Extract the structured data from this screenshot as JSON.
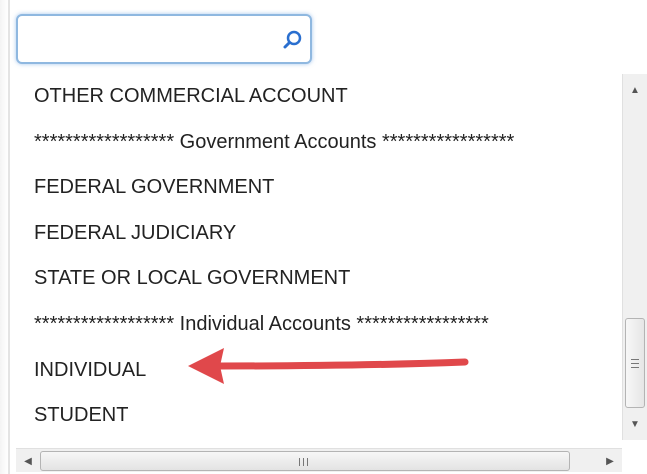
{
  "search": {
    "value": "",
    "placeholder": ""
  },
  "list": {
    "items": [
      "OTHER COMMERCIAL ACCOUNT",
      "****************** Government Accounts *****************",
      "FEDERAL GOVERNMENT",
      "FEDERAL JUDICIARY",
      "STATE OR LOCAL GOVERNMENT",
      "****************** Individual Accounts *****************",
      "INDIVIDUAL",
      "STUDENT"
    ]
  },
  "colors": {
    "arrow": "#e0484b",
    "focus_border": "#8fb8e0",
    "search_icon": "#2a6fcf"
  },
  "icons": {
    "search": "search-icon",
    "arrow": "annotation-arrow-icon",
    "scroll_up": "scroll-up-icon",
    "scroll_down": "scroll-down-icon",
    "scroll_left": "scroll-left-icon",
    "scroll_right": "scroll-right-icon"
  }
}
